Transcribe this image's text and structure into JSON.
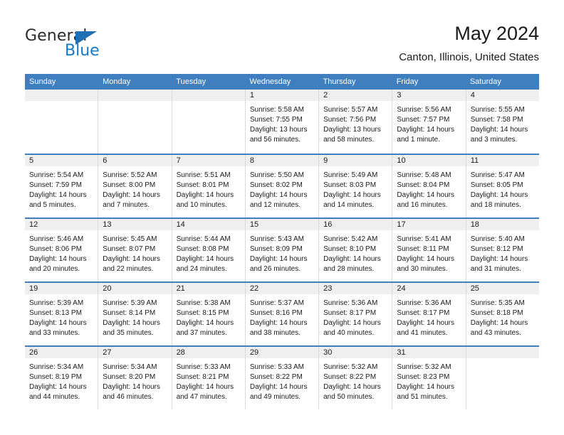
{
  "brand": {
    "name_part1": "General",
    "name_part2": "Blue",
    "color_primary": "#1779c4",
    "color_text": "#2b2b2b"
  },
  "header": {
    "title": "May 2024",
    "subtitle": "Canton, Illinois, United States"
  },
  "calendar": {
    "header_bg": "#3f7fbf",
    "daynum_bg": "#efefef",
    "weekdays": [
      "Sunday",
      "Monday",
      "Tuesday",
      "Wednesday",
      "Thursday",
      "Friday",
      "Saturday"
    ],
    "weeks": [
      [
        {
          "day": "",
          "sunrise": "",
          "sunset": "",
          "daylight_line1": "",
          "daylight_line2": ""
        },
        {
          "day": "",
          "sunrise": "",
          "sunset": "",
          "daylight_line1": "",
          "daylight_line2": ""
        },
        {
          "day": "",
          "sunrise": "",
          "sunset": "",
          "daylight_line1": "",
          "daylight_line2": ""
        },
        {
          "day": "1",
          "sunrise": "Sunrise: 5:58 AM",
          "sunset": "Sunset: 7:55 PM",
          "daylight_line1": "Daylight: 13 hours",
          "daylight_line2": "and 56 minutes."
        },
        {
          "day": "2",
          "sunrise": "Sunrise: 5:57 AM",
          "sunset": "Sunset: 7:56 PM",
          "daylight_line1": "Daylight: 13 hours",
          "daylight_line2": "and 58 minutes."
        },
        {
          "day": "3",
          "sunrise": "Sunrise: 5:56 AM",
          "sunset": "Sunset: 7:57 PM",
          "daylight_line1": "Daylight: 14 hours",
          "daylight_line2": "and 1 minute."
        },
        {
          "day": "4",
          "sunrise": "Sunrise: 5:55 AM",
          "sunset": "Sunset: 7:58 PM",
          "daylight_line1": "Daylight: 14 hours",
          "daylight_line2": "and 3 minutes."
        }
      ],
      [
        {
          "day": "5",
          "sunrise": "Sunrise: 5:54 AM",
          "sunset": "Sunset: 7:59 PM",
          "daylight_line1": "Daylight: 14 hours",
          "daylight_line2": "and 5 minutes."
        },
        {
          "day": "6",
          "sunrise": "Sunrise: 5:52 AM",
          "sunset": "Sunset: 8:00 PM",
          "daylight_line1": "Daylight: 14 hours",
          "daylight_line2": "and 7 minutes."
        },
        {
          "day": "7",
          "sunrise": "Sunrise: 5:51 AM",
          "sunset": "Sunset: 8:01 PM",
          "daylight_line1": "Daylight: 14 hours",
          "daylight_line2": "and 10 minutes."
        },
        {
          "day": "8",
          "sunrise": "Sunrise: 5:50 AM",
          "sunset": "Sunset: 8:02 PM",
          "daylight_line1": "Daylight: 14 hours",
          "daylight_line2": "and 12 minutes."
        },
        {
          "day": "9",
          "sunrise": "Sunrise: 5:49 AM",
          "sunset": "Sunset: 8:03 PM",
          "daylight_line1": "Daylight: 14 hours",
          "daylight_line2": "and 14 minutes."
        },
        {
          "day": "10",
          "sunrise": "Sunrise: 5:48 AM",
          "sunset": "Sunset: 8:04 PM",
          "daylight_line1": "Daylight: 14 hours",
          "daylight_line2": "and 16 minutes."
        },
        {
          "day": "11",
          "sunrise": "Sunrise: 5:47 AM",
          "sunset": "Sunset: 8:05 PM",
          "daylight_line1": "Daylight: 14 hours",
          "daylight_line2": "and 18 minutes."
        }
      ],
      [
        {
          "day": "12",
          "sunrise": "Sunrise: 5:46 AM",
          "sunset": "Sunset: 8:06 PM",
          "daylight_line1": "Daylight: 14 hours",
          "daylight_line2": "and 20 minutes."
        },
        {
          "day": "13",
          "sunrise": "Sunrise: 5:45 AM",
          "sunset": "Sunset: 8:07 PM",
          "daylight_line1": "Daylight: 14 hours",
          "daylight_line2": "and 22 minutes."
        },
        {
          "day": "14",
          "sunrise": "Sunrise: 5:44 AM",
          "sunset": "Sunset: 8:08 PM",
          "daylight_line1": "Daylight: 14 hours",
          "daylight_line2": "and 24 minutes."
        },
        {
          "day": "15",
          "sunrise": "Sunrise: 5:43 AM",
          "sunset": "Sunset: 8:09 PM",
          "daylight_line1": "Daylight: 14 hours",
          "daylight_line2": "and 26 minutes."
        },
        {
          "day": "16",
          "sunrise": "Sunrise: 5:42 AM",
          "sunset": "Sunset: 8:10 PM",
          "daylight_line1": "Daylight: 14 hours",
          "daylight_line2": "and 28 minutes."
        },
        {
          "day": "17",
          "sunrise": "Sunrise: 5:41 AM",
          "sunset": "Sunset: 8:11 PM",
          "daylight_line1": "Daylight: 14 hours",
          "daylight_line2": "and 30 minutes."
        },
        {
          "day": "18",
          "sunrise": "Sunrise: 5:40 AM",
          "sunset": "Sunset: 8:12 PM",
          "daylight_line1": "Daylight: 14 hours",
          "daylight_line2": "and 31 minutes."
        }
      ],
      [
        {
          "day": "19",
          "sunrise": "Sunrise: 5:39 AM",
          "sunset": "Sunset: 8:13 PM",
          "daylight_line1": "Daylight: 14 hours",
          "daylight_line2": "and 33 minutes."
        },
        {
          "day": "20",
          "sunrise": "Sunrise: 5:39 AM",
          "sunset": "Sunset: 8:14 PM",
          "daylight_line1": "Daylight: 14 hours",
          "daylight_line2": "and 35 minutes."
        },
        {
          "day": "21",
          "sunrise": "Sunrise: 5:38 AM",
          "sunset": "Sunset: 8:15 PM",
          "daylight_line1": "Daylight: 14 hours",
          "daylight_line2": "and 37 minutes."
        },
        {
          "day": "22",
          "sunrise": "Sunrise: 5:37 AM",
          "sunset": "Sunset: 8:16 PM",
          "daylight_line1": "Daylight: 14 hours",
          "daylight_line2": "and 38 minutes."
        },
        {
          "day": "23",
          "sunrise": "Sunrise: 5:36 AM",
          "sunset": "Sunset: 8:17 PM",
          "daylight_line1": "Daylight: 14 hours",
          "daylight_line2": "and 40 minutes."
        },
        {
          "day": "24",
          "sunrise": "Sunrise: 5:36 AM",
          "sunset": "Sunset: 8:17 PM",
          "daylight_line1": "Daylight: 14 hours",
          "daylight_line2": "and 41 minutes."
        },
        {
          "day": "25",
          "sunrise": "Sunrise: 5:35 AM",
          "sunset": "Sunset: 8:18 PM",
          "daylight_line1": "Daylight: 14 hours",
          "daylight_line2": "and 43 minutes."
        }
      ],
      [
        {
          "day": "26",
          "sunrise": "Sunrise: 5:34 AM",
          "sunset": "Sunset: 8:19 PM",
          "daylight_line1": "Daylight: 14 hours",
          "daylight_line2": "and 44 minutes."
        },
        {
          "day": "27",
          "sunrise": "Sunrise: 5:34 AM",
          "sunset": "Sunset: 8:20 PM",
          "daylight_line1": "Daylight: 14 hours",
          "daylight_line2": "and 46 minutes."
        },
        {
          "day": "28",
          "sunrise": "Sunrise: 5:33 AM",
          "sunset": "Sunset: 8:21 PM",
          "daylight_line1": "Daylight: 14 hours",
          "daylight_line2": "and 47 minutes."
        },
        {
          "day": "29",
          "sunrise": "Sunrise: 5:33 AM",
          "sunset": "Sunset: 8:22 PM",
          "daylight_line1": "Daylight: 14 hours",
          "daylight_line2": "and 49 minutes."
        },
        {
          "day": "30",
          "sunrise": "Sunrise: 5:32 AM",
          "sunset": "Sunset: 8:22 PM",
          "daylight_line1": "Daylight: 14 hours",
          "daylight_line2": "and 50 minutes."
        },
        {
          "day": "31",
          "sunrise": "Sunrise: 5:32 AM",
          "sunset": "Sunset: 8:23 PM",
          "daylight_line1": "Daylight: 14 hours",
          "daylight_line2": "and 51 minutes."
        },
        {
          "day": "",
          "sunrise": "",
          "sunset": "",
          "daylight_line1": "",
          "daylight_line2": ""
        }
      ]
    ]
  }
}
